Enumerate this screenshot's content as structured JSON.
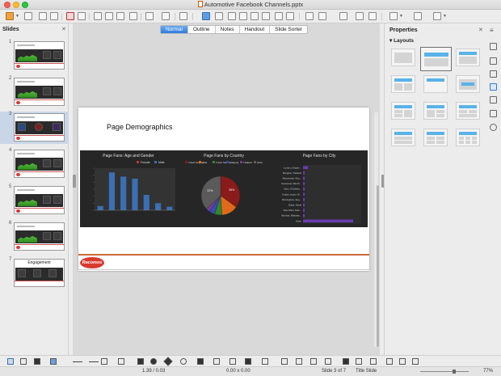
{
  "window": {
    "title": "Automotive Facebook Channels.pptx"
  },
  "view_tabs": [
    "Normal",
    "Outline",
    "Notes",
    "Handout",
    "Slide Sorter"
  ],
  "slides_panel": {
    "title": "Slides",
    "thumbnails": [
      {
        "num": "1"
      },
      {
        "num": "2"
      },
      {
        "num": "3"
      },
      {
        "num": "4"
      },
      {
        "num": "5"
      },
      {
        "num": "6"
      },
      {
        "num": "7",
        "label": "Engagement"
      }
    ]
  },
  "slide": {
    "title": "Page  Demographics",
    "logo_text": "Racomos"
  },
  "chart_data": [
    {
      "type": "bar",
      "title": "Page Fans: Age and Gender",
      "series": [
        {
          "name": "Female",
          "color": "#c0392b"
        },
        {
          "name": "Male",
          "color": "#3a6fb5"
        }
      ],
      "values": [
        6,
        54,
        48,
        45,
        22,
        10,
        5
      ],
      "ylim": [
        0,
        60
      ]
    },
    {
      "type": "pie",
      "title": "Page Fans by Country",
      "legend": [
        "United Kingdom",
        "India",
        "United States",
        "Malaysia",
        "Thailand",
        "Other"
      ],
      "colors": [
        "#8b1a1a",
        "#e06a1a",
        "#2e8a2e",
        "#3a4bb0",
        "#7a3a9a",
        "#5a5a5a"
      ],
      "values": [
        35,
        14,
        6,
        5,
        3,
        37
      ],
      "labels": [
        "35%",
        "",
        "",
        "",
        "",
        "37%"
      ]
    },
    {
      "type": "bar",
      "orientation": "horizontal",
      "title": "Page Fans by City",
      "color": "#6a3ab0",
      "categories": [
        "London, Englan...",
        "Bangkok, Thailand",
        "Manchester, Eng...",
        "Harewood, Ranch...",
        "Cairo, Al Qahira...",
        "Kuala Lumpur, W...",
        "Birmingham, Eng...",
        "Dubai, Dubai",
        "New Delhi, Delh...",
        "Mumbai, Maharas...",
        "Other"
      ],
      "values": [
        3,
        1,
        1,
        1,
        1,
        1,
        1,
        1,
        1,
        1,
        30
      ]
    }
  ],
  "properties": {
    "title": "Properties",
    "section": "Layouts"
  },
  "status": {
    "position": "1.39 / 0.03",
    "size": "0.00 x 0.00",
    "slide_info": "Slide 3 of 7",
    "master": "Title Slide",
    "zoom": "77%"
  }
}
